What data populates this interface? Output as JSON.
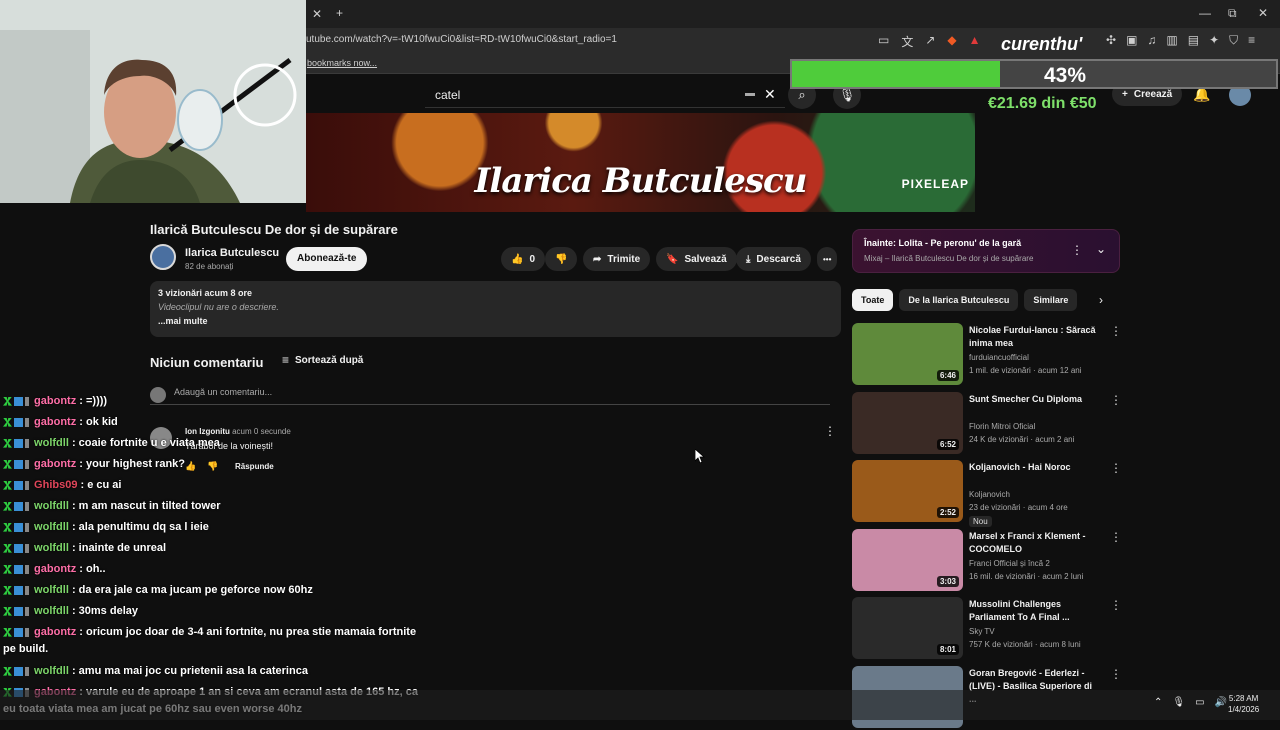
{
  "browser": {
    "url": "utube.com/watch?v=-tW10fwuCi0&list=RD-tW10fwuCi0&start_radio=1",
    "bookmarks_hint": "bookmarks now...",
    "new_tab": "+",
    "tab_close": "✕",
    "window_minimize": "—",
    "window_restore": "⧉",
    "window_close": "✕"
  },
  "header": {
    "search_value": "catel",
    "create_label": "Creează"
  },
  "banner": {
    "title": "Ilarica Butculescu",
    "logo": "PIXELEAP"
  },
  "overlay": {
    "brand": "curenthu'",
    "goal_percent_text": "43%",
    "goal_progress": 0.43,
    "goal_amount": "€21.69 din €50"
  },
  "video": {
    "title": "Ilarică Butculescu De dor și de supărare",
    "channel": "Ilarica Butculescu",
    "subs": "82 de abonați",
    "subscribe": "Abonează-te",
    "likes": "0",
    "share": "Trimite",
    "save": "Salvează",
    "download": "Descarcă",
    "more": "•••",
    "desc_line1": "3 vizionări  acum 8 ore",
    "desc_line2": "Videoclipul nu are o descriere.",
    "desc_more": "...mai multe"
  },
  "comments": {
    "heading": "Niciun comentariu",
    "sort": "Sortează după",
    "add_placeholder": "Adaugă un comentariu...",
    "user": "Ion Izgonitu",
    "time": "acum 0 secunde",
    "text": "Tărăboi de la voinești!",
    "reply": "Răspunde"
  },
  "right": {
    "upnext_title": "Înainte: Lolita - Pe peronu' de la gară",
    "upnext_sub": "Mixaj – Ilarică Butculescu De dor și de supărare",
    "chips": [
      "Toate",
      "De la Ilarica Butculescu",
      "Similare"
    ],
    "recs": [
      {
        "title": "Nicolae Furdui-Iancu : Săracă inima mea",
        "channel": "furduiancuofficial",
        "meta": "1 mil. de vizionări · acum 12 ani",
        "duration": "6:46",
        "bg": "#5f8a3b"
      },
      {
        "title": "Sunt Smecher Cu Diploma",
        "channel": "Florin Mitroi Oficial",
        "meta": "24 K de vizionări · acum 2 ani",
        "duration": "6:52",
        "bg": "#3a2a25"
      },
      {
        "title": "Koljanovich - Hai Noroc",
        "channel": "Koljanovich",
        "meta": "23 de vizionări · acum 4 ore",
        "duration": "2:52",
        "badge": "Nou",
        "bg": "#9a5a1a"
      },
      {
        "title": "Marsel x Franci x Klement - COCOMELO",
        "channel": "Franci Official și încă 2",
        "meta": "16 mil. de vizionări · acum 2 luni",
        "duration": "3:03",
        "bg": "#c98aa6"
      },
      {
        "title": "Mussolini Challenges Parliament To A Final ...",
        "channel": "Sky TV",
        "meta": "757 K de vizionări · acum 8 luni",
        "duration": "8:01",
        "bg": "#2a2a2a"
      },
      {
        "title": "Goran Bregović - Ederlezi - (LIVE) - Basilica Superiore di ...",
        "channel": "",
        "meta": "",
        "duration": "",
        "bg": "#6a7a8a"
      }
    ]
  },
  "chat": [
    {
      "user": "gabontz",
      "text": " : =))))",
      "cls": "u-gab"
    },
    {
      "user": "gabontz",
      "text": " : ok kid",
      "cls": "u-gab"
    },
    {
      "user": "wolfdll",
      "text": " : coaie fortnite u e viata mea",
      "cls": "u-wolf"
    },
    {
      "user": "gabontz",
      "text": " : your highest rank?",
      "cls": "u-gab"
    },
    {
      "user": "Ghibs09",
      "text": " : e cu ai",
      "cls": "u-ghib"
    },
    {
      "user": "wolfdll",
      "text": " : m am nascut in tilted tower",
      "cls": "u-wolf"
    },
    {
      "user": "wolfdll",
      "text": " : ala penultimu dq sa l ieie",
      "cls": "u-wolf"
    },
    {
      "user": "wolfdll",
      "text": " : inainte de unreal",
      "cls": "u-wolf"
    },
    {
      "user": "gabontz",
      "text": " : oh..",
      "cls": "u-gab"
    },
    {
      "user": "wolfdll",
      "text": " : da era jale ca ma jucam pe geforce now 60hz",
      "cls": "u-wolf"
    },
    {
      "user": "wolfdll",
      "text": " : 30ms delay",
      "cls": "u-wolf"
    },
    {
      "user": "gabontz",
      "text": " : oricum joc doar de 3-4 ani fortnite, nu prea stie mamaia fortnite",
      "cls": "u-gab",
      "cont": "pe build."
    },
    {
      "user": "wolfdll",
      "text": " : amu ma mai joc cu prietenii asa la caterinca",
      "cls": "u-wolf"
    },
    {
      "user": "gabontz",
      "text": " : varule eu de aproape 1 an si ceva am ecranul asta de 165 hz, ca",
      "cls": "u-gab",
      "cont": "eu toata viata mea am jucat pe 60hz sau even worse 40hz"
    }
  ],
  "taskbar": {
    "time": "5:28 AM",
    "date": "1/4/2026"
  },
  "colors": {
    "goal_fill": "#4fcc3b",
    "goal_amount": "#7ee06a",
    "bg": "#0f0f0f"
  }
}
